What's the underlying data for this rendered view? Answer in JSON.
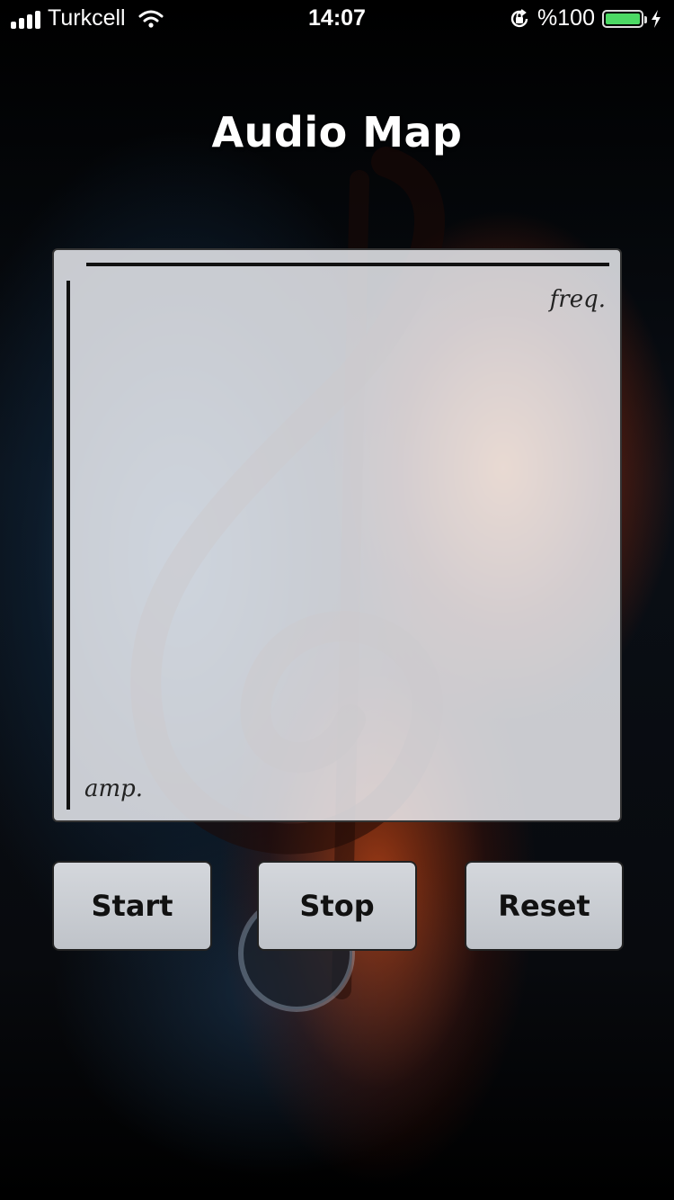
{
  "status_bar": {
    "carrier": "Turkcell",
    "time": "14:07",
    "battery_percent": "%100",
    "battery_level": 1.0,
    "icons": [
      "signal-icon",
      "wifi-icon",
      "orientation-lock-icon",
      "battery-icon",
      "charging-icon"
    ]
  },
  "app": {
    "title": "Audio Map"
  },
  "map": {
    "x_axis_label": "freq.",
    "y_axis_label": "amp."
  },
  "buttons": {
    "start": "Start",
    "stop": "Stop",
    "reset": "Reset"
  },
  "colors": {
    "battery_green": "#4cd964",
    "panel": "#eef0f4",
    "button": "#c8cbd0"
  }
}
